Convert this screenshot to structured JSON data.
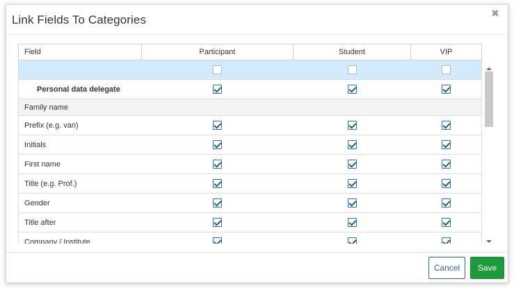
{
  "dialog": {
    "title": "Link Fields To Categories",
    "close_icon": "close-icon"
  },
  "table": {
    "headers": [
      "Field",
      "Participant",
      "Student",
      "VIP"
    ],
    "rows": [
      {
        "type": "select-all",
        "label": "",
        "checked": [
          false,
          false,
          false
        ]
      },
      {
        "type": "delegate",
        "label": "Personal data delegate",
        "checked": [
          true,
          true,
          true
        ]
      },
      {
        "type": "group",
        "label": "Family name",
        "checked": []
      },
      {
        "type": "field",
        "label": "Prefix (e.g. van)",
        "checked": [
          true,
          true,
          true
        ]
      },
      {
        "type": "field",
        "label": "Initials",
        "checked": [
          true,
          true,
          true
        ]
      },
      {
        "type": "field",
        "label": "First name",
        "checked": [
          true,
          true,
          true
        ]
      },
      {
        "type": "field",
        "label": "Title (e.g. Prof.)",
        "checked": [
          true,
          true,
          true
        ]
      },
      {
        "type": "field",
        "label": "Gender",
        "checked": [
          true,
          true,
          true
        ]
      },
      {
        "type": "field",
        "label": "Title after",
        "checked": [
          true,
          true,
          true
        ]
      },
      {
        "type": "field",
        "label": "Company / Institute",
        "checked": [
          true,
          true,
          true
        ]
      }
    ]
  },
  "footer": {
    "cancel_label": "Cancel",
    "save_label": "Save"
  },
  "colors": {
    "accent": "#2a6395",
    "save": "#1e9a3c",
    "select_all_row": "#d3eafc"
  }
}
